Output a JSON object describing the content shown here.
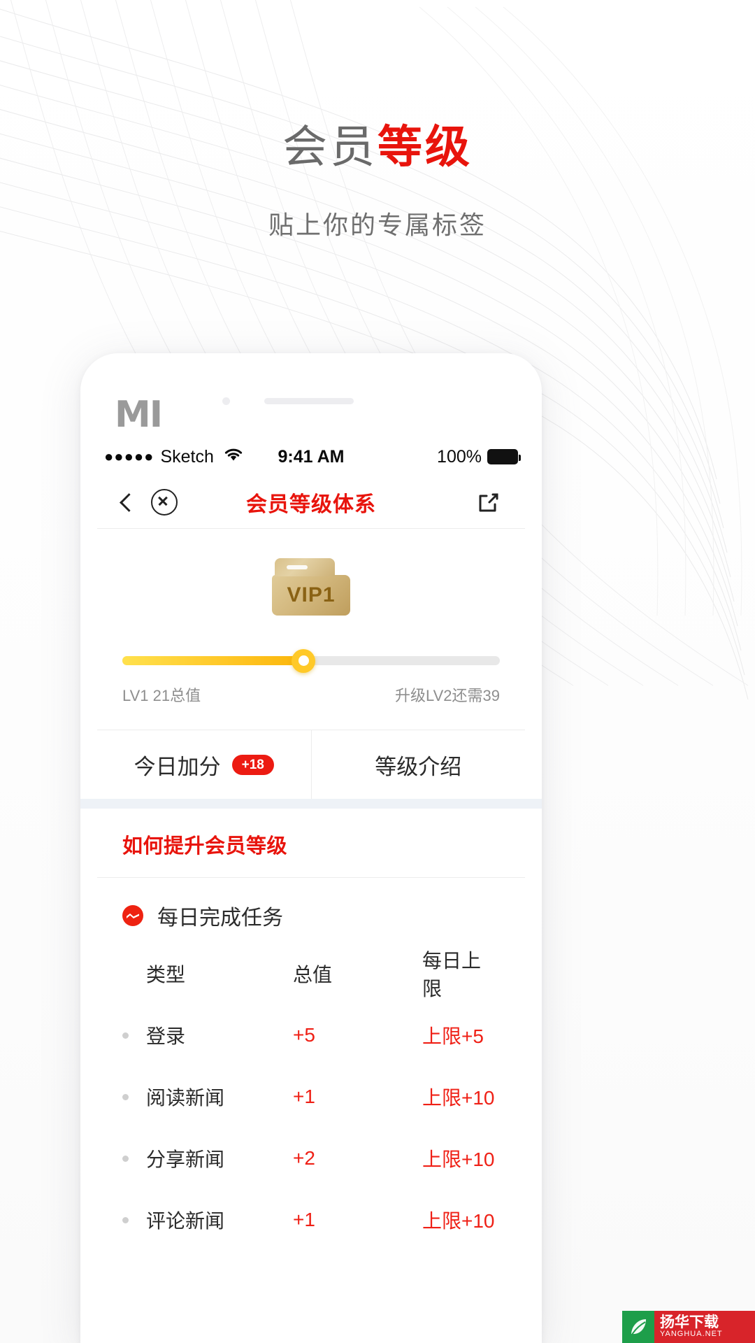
{
  "promo": {
    "title_gray": "会员",
    "title_red": "等级",
    "subtitle": "贴上你的专属标签"
  },
  "phone": {
    "brand_logo": "MI",
    "statusbar": {
      "signal_dots": "●●●●●",
      "carrier": "Sketch",
      "wifi_icon": "wifi-icon",
      "time": "9:41 AM",
      "battery_text": "100%",
      "battery_icon": "battery-full-icon"
    },
    "navbar": {
      "back_icon": "chevron-left-icon",
      "close_icon": "close-circle-icon",
      "title": "会员等级体系",
      "share_icon": "share-external-icon"
    },
    "vip": {
      "card_label": "VIP1",
      "progress_percent": 48,
      "level_label": "LV1  21总值",
      "next_level_label": "升级LV2还需39"
    },
    "tabs": [
      {
        "label": "今日加分",
        "badge": "+18",
        "active": true
      },
      {
        "label": "等级介绍",
        "badge": "",
        "active": false
      }
    ],
    "section": {
      "title": "如何提升会员等级",
      "task_icon": "pulse-badge-icon",
      "task_title": "每日完成任务",
      "table": {
        "headers": [
          "类型",
          "总值",
          "每日上限"
        ],
        "rows": [
          {
            "type": "登录",
            "value": "+5",
            "cap": "上限+5"
          },
          {
            "type": "阅读新闻",
            "value": "+1",
            "cap": "上限+10"
          },
          {
            "type": "分享新闻",
            "value": "+2",
            "cap": "上限+10"
          },
          {
            "type": "评论新闻",
            "value": "+1",
            "cap": "上限+10"
          }
        ]
      }
    }
  },
  "watermark": {
    "name": "扬华下载",
    "site": "YANGHUA.NET"
  },
  "colors": {
    "brand_red": "#e8140c",
    "accent_yellow": "#ffc829",
    "gold": "#cdb177"
  }
}
